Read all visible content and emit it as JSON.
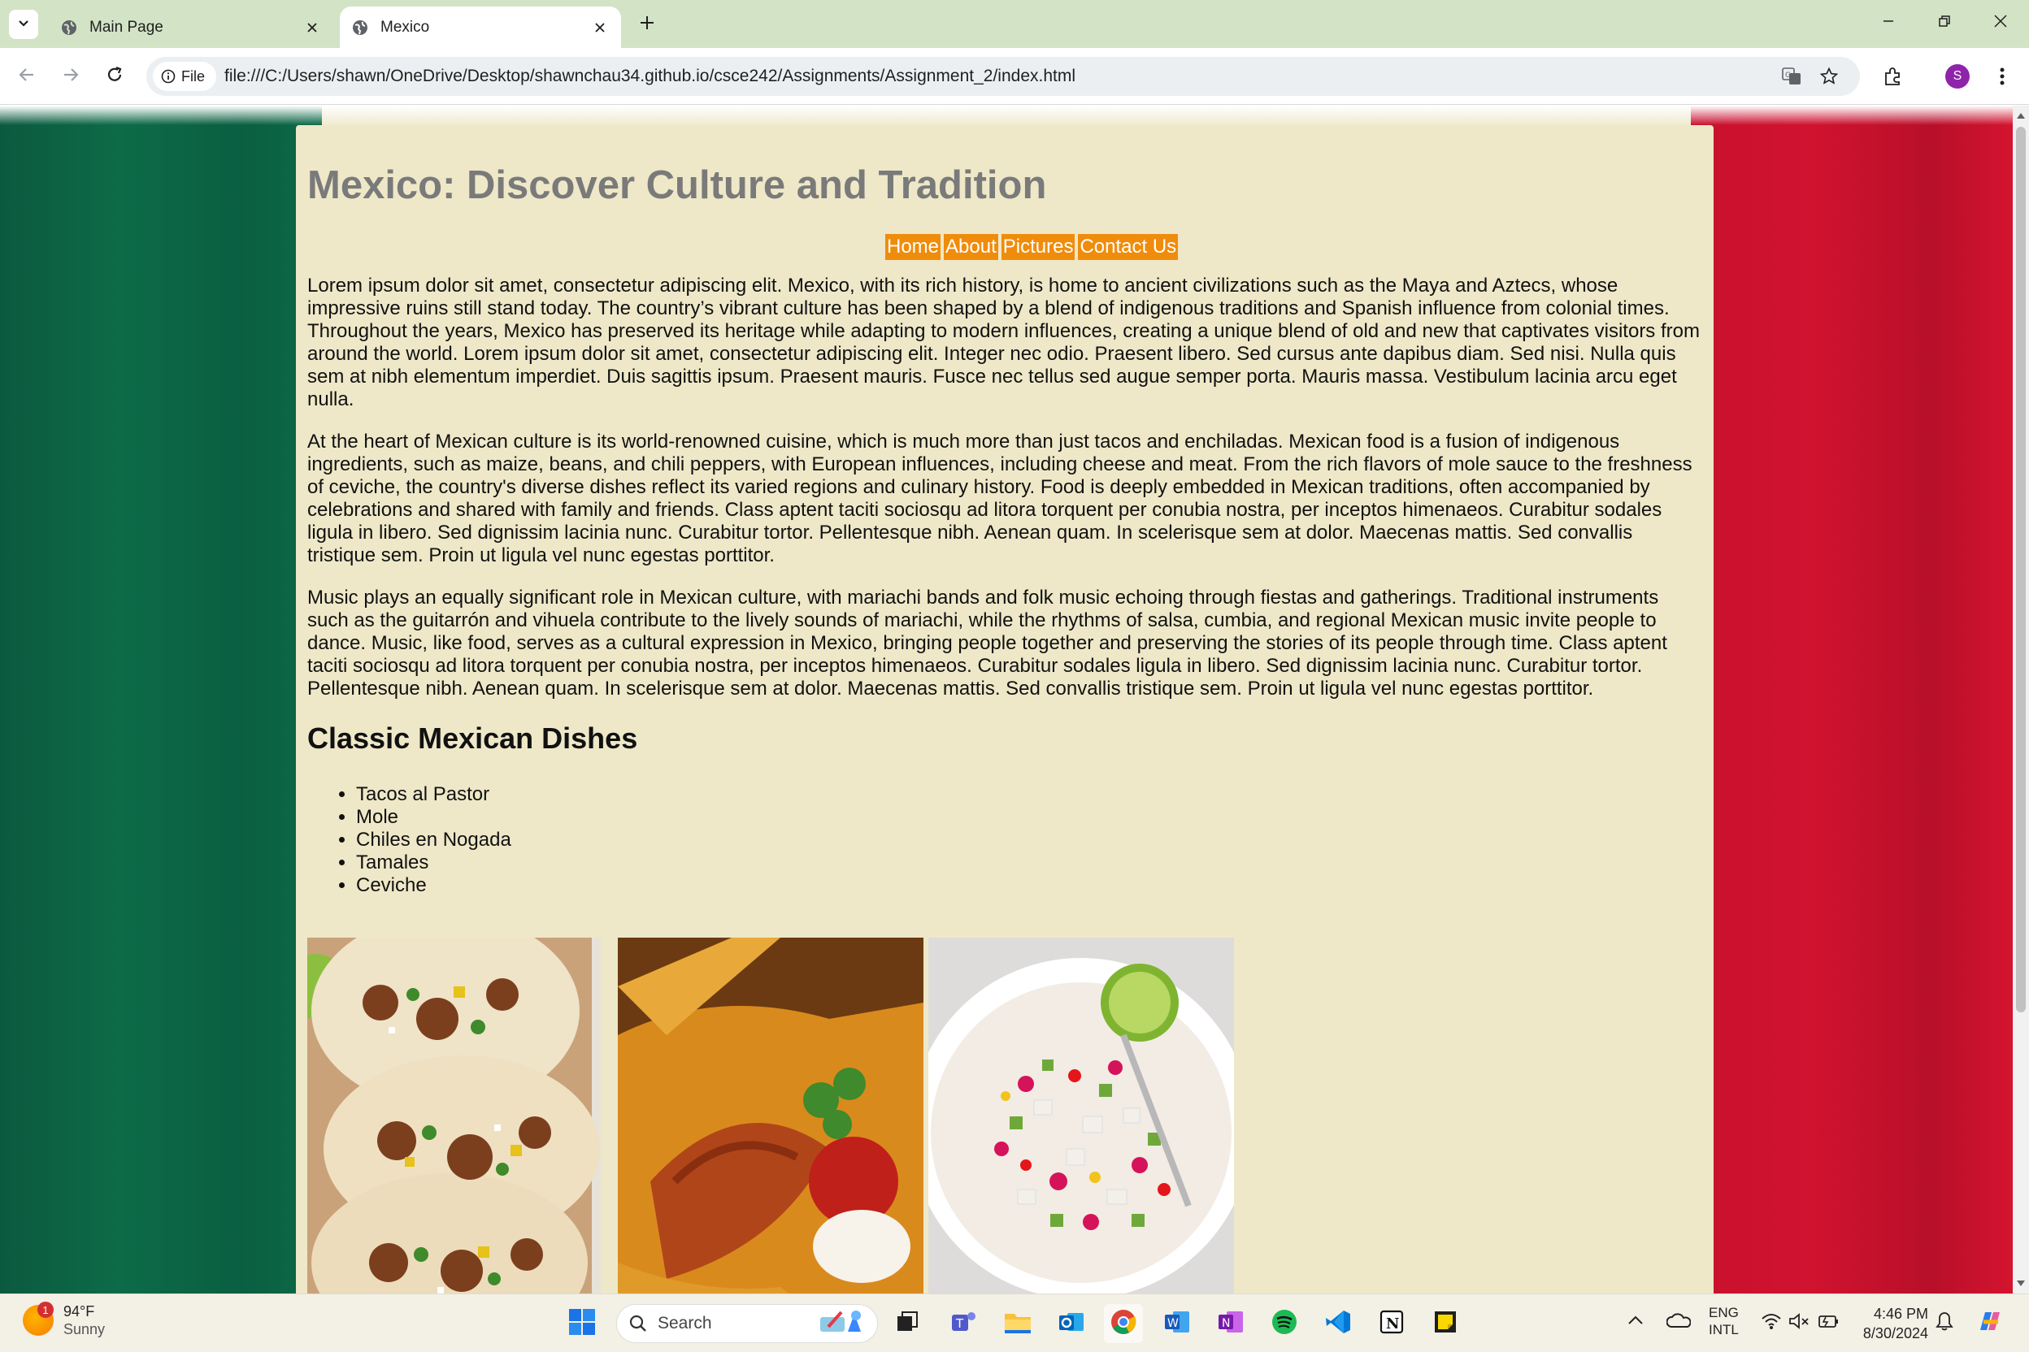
{
  "browser": {
    "tabs": [
      {
        "label": "Main Page",
        "active": false
      },
      {
        "label": "Mexico",
        "active": true
      }
    ],
    "site_chip": "File",
    "url": "file:///C:/Users/shawn/OneDrive/Desktop/shawnchau34.github.io/csce242/Assignments/Assignment_2/index.html",
    "profile_initial": "S"
  },
  "page": {
    "title": "Mexico: Discover Culture and Tradition",
    "nav": [
      "Home",
      "About",
      "Pictures",
      "Contact Us"
    ],
    "paragraphs": [
      "Lorem ipsum dolor sit amet, consectetur adipiscing elit. Mexico, with its rich history, is home to ancient civilizations such as the Maya and Aztecs, whose impressive ruins still stand today. The country’s vibrant culture has been shaped by a blend of indigenous traditions and Spanish influence from colonial times. Throughout the years, Mexico has preserved its heritage while adapting to modern influences, creating a unique blend of old and new that captivates visitors from around the world. Lorem ipsum dolor sit amet, consectetur adipiscing elit. Integer nec odio. Praesent libero. Sed cursus ante dapibus diam. Sed nisi. Nulla quis sem at nibh elementum imperdiet. Duis sagittis ipsum. Praesent mauris. Fusce nec tellus sed augue semper porta. Mauris massa. Vestibulum lacinia arcu eget nulla.",
      "At the heart of Mexican culture is its world-renowned cuisine, which is much more than just tacos and enchiladas. Mexican food is a fusion of indigenous ingredients, such as maize, beans, and chili peppers, with European influences, including cheese and meat. From the rich flavors of mole sauce to the freshness of ceviche, the country's diverse dishes reflect its varied regions and culinary history. Food is deeply embedded in Mexican traditions, often accompanied by celebrations and shared with family and friends. Class aptent taciti sociosqu ad litora torquent per conubia nostra, per inceptos himenaeos. Curabitur sodales ligula in libero. Sed dignissim lacinia nunc. Curabitur tortor. Pellentesque nibh. Aenean quam. In scelerisque sem at dolor. Maecenas mattis. Sed convallis tristique sem. Proin ut ligula vel nunc egestas porttitor.",
      "Music plays an equally significant role in Mexican culture, with mariachi bands and folk music echoing through fiestas and gatherings. Traditional instruments such as the guitarrón and vihuela contribute to the lively sounds of mariachi, while the rhythms of salsa, cumbia, and regional Mexican music invite people to dance. Music, like food, serves as a cultural expression in Mexico, bringing people together and preserving the stories of its people through time. Class aptent taciti sociosqu ad litora torquent per conubia nostra, per inceptos himenaeos. Curabitur sodales ligula in libero. Sed dignissim lacinia nunc. Curabitur tortor. Pellentesque nibh. Aenean quam. In scelerisque sem at dolor. Maecenas mattis. Sed convallis tristique sem. Proin ut ligula vel nunc egestas porttitor."
    ],
    "dishes_heading": "Classic Mexican Dishes",
    "dishes": [
      "Tacos al Pastor",
      "Mole",
      "Chiles en Nogada",
      "Tamales",
      "Ceviche"
    ],
    "photos": [
      "tacos-photo",
      "tamales-photo",
      "ceviche-photo"
    ],
    "colors": {
      "content_bg": "#eee8c8",
      "nav_bg": "#f08c0c",
      "title": "#7a7a7a",
      "flag_green": "#0b5a3f",
      "flag_red": "#c8102e"
    }
  },
  "taskbar": {
    "weather_temp": "94°F",
    "weather_desc": "Sunny",
    "weather_badge": "1",
    "search_placeholder": "Search",
    "lang_top": "ENG",
    "lang_bottom": "INTL",
    "time": "4:46 PM",
    "date": "8/30/2024"
  }
}
